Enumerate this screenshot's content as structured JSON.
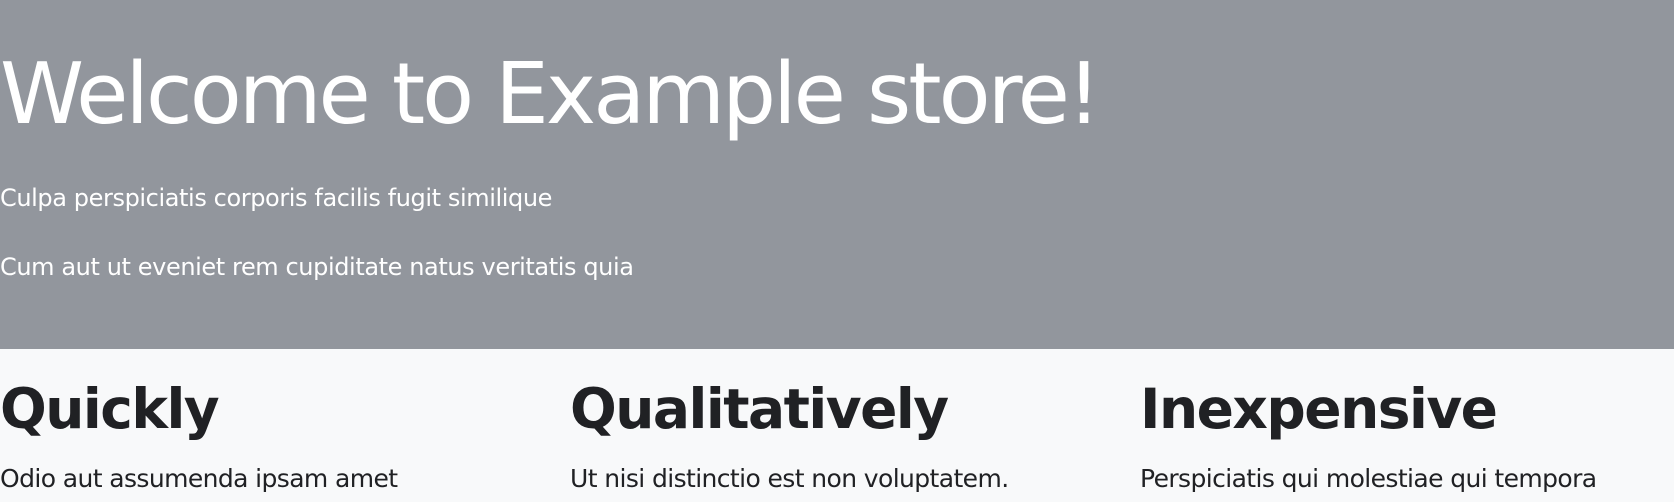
{
  "hero": {
    "title": "Welcome to Example store!",
    "subtitle_1": "Culpa perspiciatis corporis facilis fugit similique",
    "subtitle_2": "Cum aut ut eveniet rem cupiditate natus veritatis quia"
  },
  "features": [
    {
      "title": "Quickly",
      "text": "Odio aut assumenda ipsam amet"
    },
    {
      "title": "Qualitatively",
      "text": "Ut nisi distinctio est non voluptatem."
    },
    {
      "title": "Inexpensive",
      "text": "Perspiciatis qui molestiae qui tempora"
    }
  ],
  "colors": {
    "hero_background": "#92969d",
    "hero_text": "#ffffff",
    "body_background": "#f8f9fa",
    "body_text": "#202124"
  }
}
